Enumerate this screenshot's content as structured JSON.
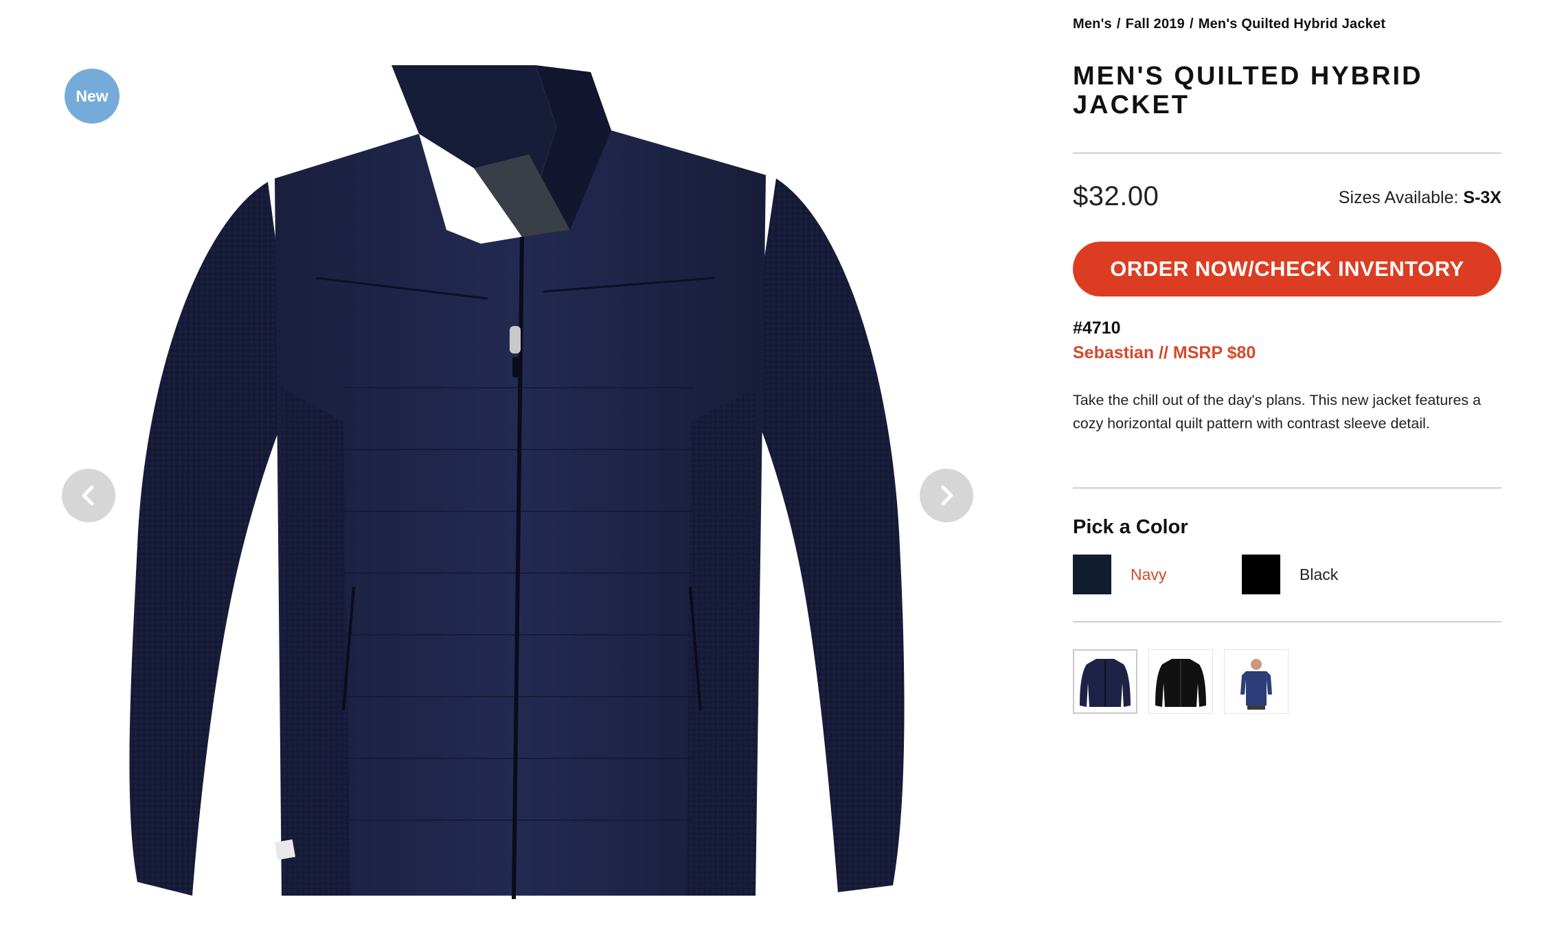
{
  "gallery": {
    "badge": "New",
    "prev_icon": "chevron-left-icon",
    "next_icon": "chevron-right-icon",
    "image": "navy-quilted-hybrid-jacket"
  },
  "breadcrumb": {
    "items": [
      "Men's",
      "Fall 2019",
      "Men's Quilted Hybrid Jacket"
    ],
    "separator": "/"
  },
  "product": {
    "title": "MEN'S QUILTED HYBRID JACKET",
    "price": "$32.00",
    "sizes_label": "Sizes Available:",
    "sizes_value": "S-3X",
    "order_button": "ORDER NOW/CHECK INVENTORY",
    "sku": "#4710",
    "brand_msrp": "Sebastian // MSRP $80",
    "description": "Take the chill out of the day's plans. This new jacket features a cozy horizontal quilt pattern with contrast sleeve detail."
  },
  "colors": {
    "heading": "Pick a Color",
    "options": [
      {
        "label": "Navy",
        "swatch": "#0f1d2e",
        "label_color": "#d24a2c",
        "selected": true
      },
      {
        "label": "Black",
        "swatch": "#000000",
        "label_color": "#222222",
        "selected": false
      }
    ]
  },
  "thumbnails": [
    {
      "name": "navy-jacket-thumb",
      "selected": true
    },
    {
      "name": "black-jacket-thumb",
      "selected": false
    },
    {
      "name": "model-wearing-jacket-thumb",
      "selected": false
    }
  ],
  "theme": {
    "accent": "#dc3d22",
    "brand_text": "#d24a2c",
    "badge": "#74abd9",
    "navy": "#1a2140",
    "divider": "#cfcfcf"
  }
}
